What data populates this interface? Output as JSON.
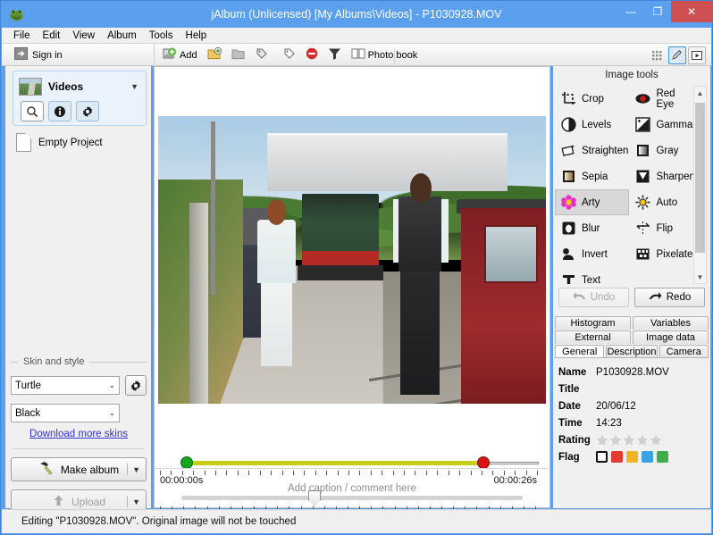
{
  "window": {
    "title": "jAlbum (Unlicensed) [My Albums\\Videos] - P1030928.MOV",
    "app_icon": "jalbum-frog-icon",
    "minimize_label": "—",
    "maximize_label": "❐",
    "close_label": "✕",
    "titlebar_color": "#5aa0ee",
    "close_color": "#cf5050"
  },
  "menubar": {
    "items": [
      {
        "label": "File"
      },
      {
        "label": "Edit"
      },
      {
        "label": "View"
      },
      {
        "label": "Album"
      },
      {
        "label": "Tools"
      },
      {
        "label": "Help"
      }
    ]
  },
  "toolbar": {
    "signin_label": "Sign in",
    "buttons": [
      {
        "label": "Add",
        "icon": "add-image-icon"
      },
      {
        "label": "",
        "icon": "new-folder-icon"
      },
      {
        "label": "",
        "icon": "folder-icon"
      },
      {
        "label": "",
        "icon": "tag-icon"
      },
      {
        "label": "",
        "icon": "tag-outline-icon"
      },
      {
        "label": "",
        "icon": "remove-icon"
      },
      {
        "label": "",
        "icon": "filter-icon"
      },
      {
        "label": "Photo book",
        "icon": "photo-book-icon"
      }
    ],
    "view_buttons": [
      {
        "icon": "grid-view-icon",
        "selected": false
      },
      {
        "icon": "edit-view-icon",
        "selected": true
      },
      {
        "icon": "player-view-icon",
        "selected": false
      }
    ]
  },
  "sidebar": {
    "album": {
      "name": "Videos",
      "caret": "▼",
      "buttons": [
        {
          "icon": "search-icon",
          "name": "search",
          "active": true
        },
        {
          "icon": "info-icon",
          "name": "info",
          "active": false
        },
        {
          "icon": "gear-icon",
          "name": "settings",
          "active": false
        }
      ]
    },
    "projects": [
      {
        "label": "Empty Project",
        "icon": "document-icon"
      }
    ],
    "skin_section": {
      "title": "Skin and style",
      "skin_value": "Turtle",
      "style_value": "Black",
      "caret": "⌄",
      "download_link": "Download more skins",
      "make_album_label": "Make album",
      "upload_label": "Upload",
      "split_caret": "▼"
    }
  },
  "center": {
    "timeline": {
      "start_time": "00:00:00s",
      "end_time": "00:00:26s",
      "start_marker_color": "#16a61d",
      "end_marker_color": "#d81414",
      "track_color": "#c9cf18"
    },
    "position_slider": {
      "start_time": "00:00:00s",
      "end_time": "00:00:26s"
    },
    "caption_placeholder": "Add caption / comment here"
  },
  "image_tools": {
    "panel_title": "Image tools",
    "tools": [
      {
        "label": "Crop",
        "icon": "crop-icon",
        "selected": false
      },
      {
        "label": "Red Eye",
        "icon": "red-eye-icon",
        "selected": false
      },
      {
        "label": "Levels",
        "icon": "levels-icon",
        "selected": false
      },
      {
        "label": "Gamma",
        "icon": "gamma-icon",
        "selected": false
      },
      {
        "label": "Straighten",
        "icon": "straighten-icon",
        "selected": false
      },
      {
        "label": "Gray",
        "icon": "gray-icon",
        "selected": false
      },
      {
        "label": "Sepia",
        "icon": "sepia-icon",
        "selected": false
      },
      {
        "label": "Sharpen",
        "icon": "sharpen-icon",
        "selected": false
      },
      {
        "label": "Arty",
        "icon": "arty-icon",
        "selected": true
      },
      {
        "label": "Auto",
        "icon": "auto-icon",
        "selected": false
      },
      {
        "label": "Blur",
        "icon": "blur-icon",
        "selected": false
      },
      {
        "label": "Flip",
        "icon": "flip-icon",
        "selected": false
      },
      {
        "label": "Invert",
        "icon": "invert-icon",
        "selected": false
      },
      {
        "label": "Pixelate",
        "icon": "pixelate-icon",
        "selected": false
      },
      {
        "label": "Text",
        "icon": "text-icon",
        "selected": false
      }
    ],
    "undo_label": "Undo",
    "redo_label": "Redo",
    "undo_enabled": false,
    "redo_enabled": true
  },
  "metadata": {
    "tabs_row1": [
      {
        "label": "Histogram",
        "active": false
      },
      {
        "label": "Variables",
        "active": false
      }
    ],
    "tabs_row2": [
      {
        "label": "External",
        "active": false
      },
      {
        "label": "Image data",
        "active": false
      }
    ],
    "tabs_row3": [
      {
        "label": "General",
        "active": true
      },
      {
        "label": "Description",
        "active": false
      },
      {
        "label": "Camera",
        "active": false
      }
    ],
    "fields": [
      {
        "key": "Name",
        "value": "P1030928.MOV"
      },
      {
        "key": "Title",
        "value": ""
      },
      {
        "key": "Date",
        "value": "20/06/12"
      },
      {
        "key": "Time",
        "value": "14:23"
      }
    ],
    "rating_label": "Rating",
    "rating_value": 0,
    "rating_max": 5,
    "flag_label": "Flag",
    "flags": [
      "none",
      "#e03a31",
      "#f0b429",
      "#3aa3e3",
      "#3fae4a"
    ]
  },
  "statusbar": {
    "text": "Editing \"P1030928.MOV\". Original image will not be touched"
  }
}
